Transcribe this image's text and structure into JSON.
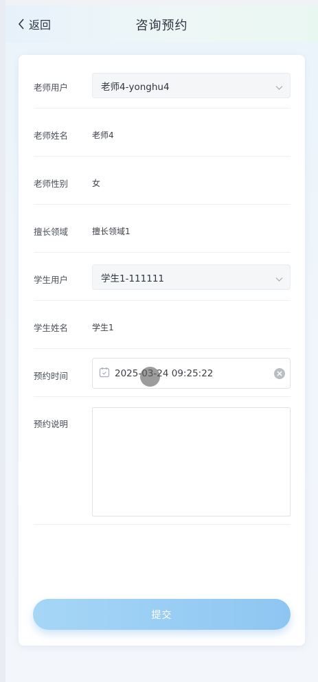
{
  "header": {
    "back_label": "返回",
    "title": "咨询预约"
  },
  "form": {
    "teacher_user": {
      "label": "老师用户",
      "value": "老师4-yonghu4"
    },
    "teacher_name": {
      "label": "老师姓名",
      "value": "老师4"
    },
    "teacher_gender": {
      "label": "老师性别",
      "value": "女"
    },
    "expertise": {
      "label": "擅长领域",
      "value": "擅长领域1"
    },
    "student_user": {
      "label": "学生用户",
      "value": "学生1-111111"
    },
    "student_name": {
      "label": "学生姓名",
      "value": "学生1"
    },
    "appointment_time": {
      "label": "预约时间",
      "value": "2025-03-24 09:25:22"
    },
    "appointment_note": {
      "label": "预约说明",
      "value": ""
    }
  },
  "submit_label": "提交",
  "icons": {
    "back": "chevron-left-icon",
    "dropdown": "chevron-down-icon",
    "calendar": "calendar-icon",
    "clear": "circle-close-icon"
  },
  "colors": {
    "accent": "#8ec6f2",
    "text": "#2f3440"
  }
}
